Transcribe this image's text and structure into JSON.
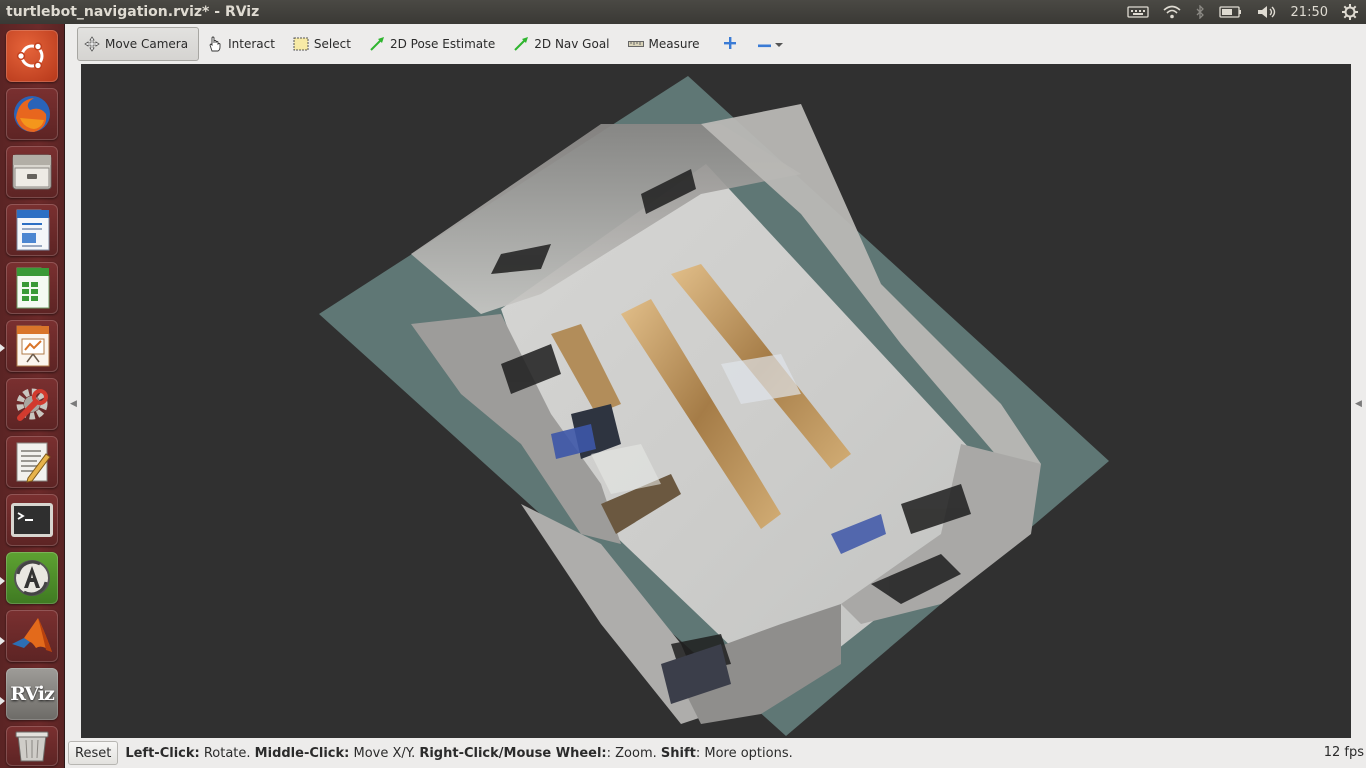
{
  "top_panel": {
    "window_title": "turtlebot_navigation.rviz* - RViz",
    "clock": "21:50"
  },
  "launcher": {
    "items": [
      "Ubuntu Dash",
      "Firefox",
      "Files",
      "LibreOffice Writer",
      "LibreOffice Calc",
      "LibreOffice Impress",
      "System Settings",
      "Text Editor",
      "Terminal",
      "Software Updater",
      "MATLAB",
      "RViz",
      "Trash"
    ],
    "rviz_label": "RViz"
  },
  "toolbar": {
    "move_camera": "Move Camera",
    "interact": "Interact",
    "select": "Select",
    "pose_estimate": "2D Pose Estimate",
    "nav_goal": "2D Nav Goal",
    "measure": "Measure"
  },
  "statusbar": {
    "reset": "Reset",
    "left_click": "Left-Click:",
    "rotate": " Rotate. ",
    "middle_click": "Middle-Click:",
    "move_xy": " Move X/Y. ",
    "right_click": "Right-Click/Mouse Wheel:",
    "zoom": ": Zoom. ",
    "shift": "Shift",
    "more": ": More options.",
    "fps": "12 fps"
  },
  "colors": {
    "ground_plane": "#5f7775",
    "viewport_bg": "#303030",
    "launcher": "#6d2a2a"
  }
}
